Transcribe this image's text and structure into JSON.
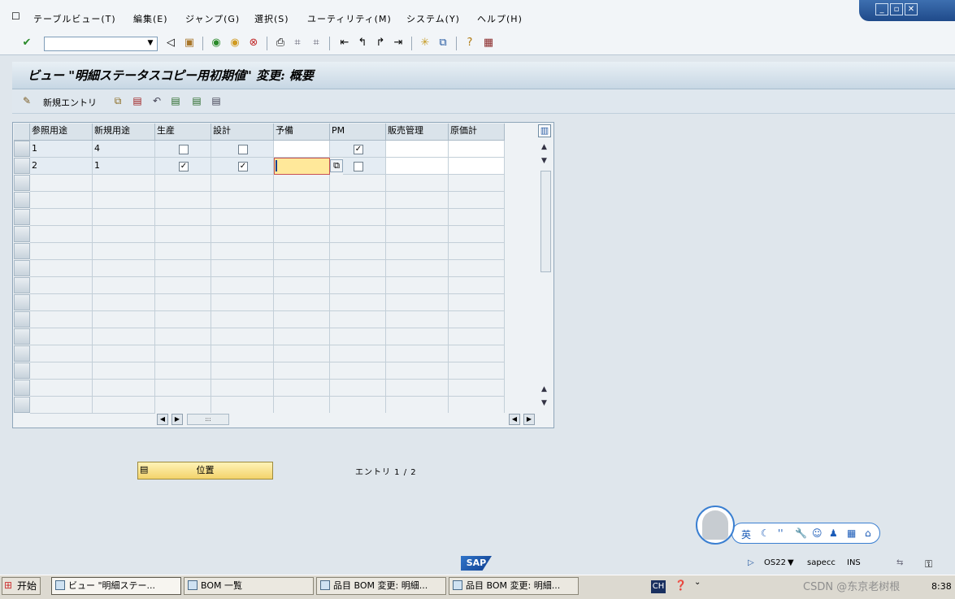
{
  "menu": {
    "items": [
      "テーブルビュー(T)",
      "編集(E)",
      "ジャンプ(G)",
      "選択(S)",
      "ユーティリティ(M)",
      "システム(Y)",
      "ヘルプ(H)"
    ]
  },
  "window_controls": {
    "minimize": "_",
    "restore": "▫",
    "close": "✕"
  },
  "toolbar": {
    "command_value": "",
    "icons": [
      "checkmark-icon",
      "back-icon",
      "save-icon",
      "back-green-icon",
      "exit-icon",
      "cancel-icon",
      "print-icon",
      "find-icon",
      "find-next-icon",
      "first-page-icon",
      "prev-page-icon",
      "next-page-icon",
      "last-page-icon",
      "new-session-icon",
      "shortcut-icon",
      "help-icon",
      "layout-icon"
    ]
  },
  "page": {
    "title": "ビュー \"明細ステータスコピー用初期値\" 変更: 概要"
  },
  "app_toolbar": {
    "new_entry": "新規エントリ"
  },
  "table": {
    "columns": [
      "参照用途",
      "新規用途",
      "生産",
      "設計",
      "予備",
      "PM",
      "販売管理",
      "原価計"
    ],
    "rows": [
      {
        "ref": "1",
        "new": "4",
        "prod": false,
        "design": false,
        "spare": "",
        "pm": true,
        "sales": "",
        "cost": ""
      },
      {
        "ref": "2",
        "new": "1",
        "prod": true,
        "design": true,
        "spare": "",
        "pm": false,
        "sales": "",
        "cost": ""
      }
    ]
  },
  "position_button": {
    "label": "位置"
  },
  "entry_count": "エントリ 1 / 2",
  "status": {
    "logo": "SAP",
    "system": "OS22",
    "server": "sapecc",
    "mode": "INS"
  },
  "ime": {
    "lang": "英"
  },
  "taskbar": {
    "start": "开始",
    "tasks": [
      "ビュー \"明細ステー...",
      "BOM 一覧",
      "品目 BOM 変更: 明細...",
      "品目 BOM 変更: 明細..."
    ],
    "lang": "CH",
    "watermark": "CSDN @东京老树根",
    "clock": "8:38"
  }
}
